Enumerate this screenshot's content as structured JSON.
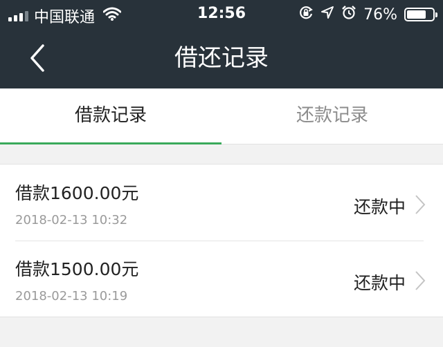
{
  "status_bar": {
    "carrier": "中国联通",
    "time": "12:56",
    "battery_percent": "76%",
    "battery_level": 0.76,
    "icons": [
      "signal-icon",
      "wifi-icon",
      "rotation-lock-icon",
      "location-icon",
      "alarm-icon",
      "battery-icon"
    ]
  },
  "nav": {
    "title": "借还记录",
    "back_icon": "chevron-left-icon"
  },
  "tabs": [
    {
      "label": "借款记录",
      "active": true
    },
    {
      "label": "还款记录",
      "active": false
    }
  ],
  "records": [
    {
      "title": "借款1600.00元",
      "time": "2018-02-13 10:32",
      "status": "还款中"
    },
    {
      "title": "借款1500.00元",
      "time": "2018-02-13 10:19",
      "status": "还款中"
    }
  ],
  "colors": {
    "header_bg": "#28323a",
    "accent": "#3aaa5a",
    "background": "#f2f2f2"
  }
}
